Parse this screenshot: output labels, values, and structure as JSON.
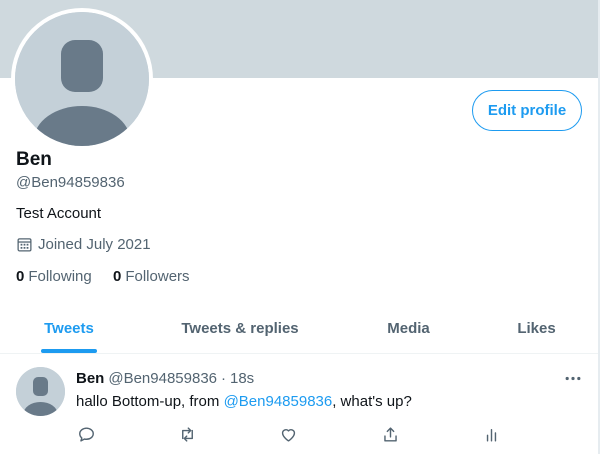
{
  "colors": {
    "accent": "#1d9bf0",
    "banner": "#cfd9de",
    "muted": "#536471",
    "text": "#0f1419",
    "avatar": "#c4d0d8"
  },
  "profile": {
    "name": "Ben",
    "handle": "@Ben94859836",
    "bio": "Test Account",
    "joined": "Joined July 2021",
    "edit_label": "Edit profile",
    "following_count": "0",
    "following_label": "Following",
    "followers_count": "0",
    "followers_label": "Followers"
  },
  "tabs": [
    {
      "label": "Tweets",
      "active": true
    },
    {
      "label": "Tweets & replies",
      "active": false
    },
    {
      "label": "Media",
      "active": false
    },
    {
      "label": "Likes",
      "active": false
    }
  ],
  "tweet": {
    "name": "Ben",
    "handle": "@Ben94859836",
    "dot": "·",
    "time": "18s",
    "text_before": "hallo Bottom-up, from ",
    "mention": "@Ben94859836",
    "text_after": ", what's up?",
    "more_icon": "more-horizontal-icon",
    "actions": [
      "reply-icon",
      "retweet-icon",
      "like-icon",
      "share-icon",
      "analytics-icon"
    ]
  }
}
